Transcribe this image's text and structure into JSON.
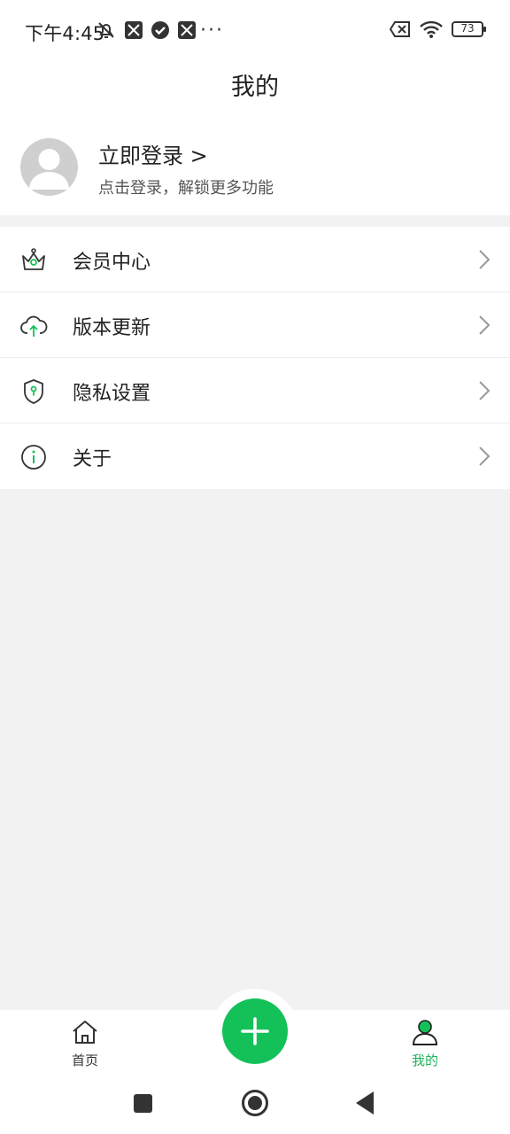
{
  "status_bar": {
    "time": "下午4:45",
    "more_dots": "···",
    "battery_level": "73",
    "icons_left": [
      "mute-bell-icon",
      "app-notification-icon",
      "check-circle-icon",
      "app-notification-icon"
    ],
    "icons_right": [
      "sim-disabled-icon",
      "wifi-icon",
      "battery-icon"
    ]
  },
  "header": {
    "title": "我的"
  },
  "profile": {
    "login_title": "立即登录 >",
    "login_subtitle": "点击登录，解锁更多功能"
  },
  "menu": {
    "items": [
      {
        "label": "会员中心",
        "icon": "crown-icon"
      },
      {
        "label": "版本更新",
        "icon": "cloud-upload-icon"
      },
      {
        "label": "隐私设置",
        "icon": "shield-icon"
      },
      {
        "label": "关于",
        "icon": "info-icon"
      }
    ]
  },
  "bottom_nav": {
    "home_label": "首页",
    "me_label": "我的",
    "active": "me"
  },
  "colors": {
    "accent": "#14c159",
    "active_text": "#21b35b",
    "background": "#f2f2f2"
  }
}
